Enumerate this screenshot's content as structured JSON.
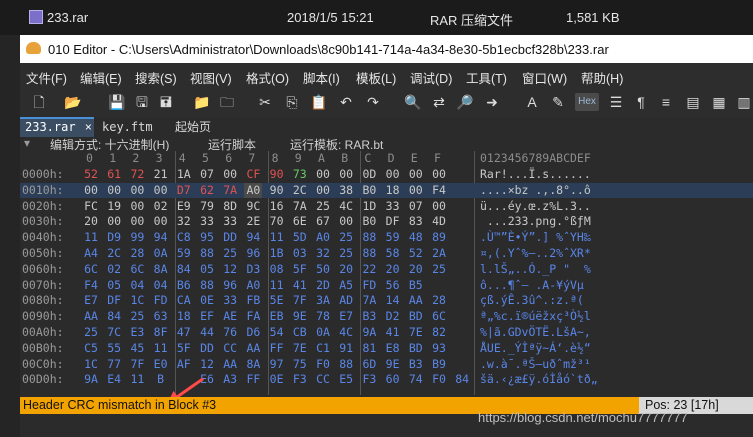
{
  "explorer": {
    "file_name": "233.rar",
    "file_date": "2018/1/5 15:21",
    "file_type": "RAR 压缩文件",
    "file_size": "1,581 KB"
  },
  "window": {
    "title": "010 Editor - C:\\Users\\Administrator\\Downloads\\8c90b141-714a-4a34-8e30-5b1ecbcf328b\\233.rar"
  },
  "menu": [
    "文件(F)",
    "编辑(E)",
    "搜索(S)",
    "视图(V)",
    "格式(O)",
    "脚本(I)",
    "模板(L)",
    "调试(D)",
    "工具(T)",
    "窗口(W)",
    "帮助(H)"
  ],
  "toolbar": {
    "hex_label": "Hex"
  },
  "tabs": [
    {
      "label": "233.rar",
      "close": "×"
    },
    {
      "label": "key.ftm"
    },
    {
      "label": "起始页"
    }
  ],
  "options": {
    "edit_mode": "编辑方式: 十六进制(H)",
    "run_script": "运行脚本",
    "run_template": "运行模板: RAR.bt"
  },
  "hex": {
    "column_headers": [
      "0",
      "1",
      "2",
      "3",
      "4",
      "5",
      "6",
      "7",
      "8",
      "9",
      "A",
      "B",
      "C",
      "D",
      "E",
      "F"
    ],
    "ascii_header": "0123456789ABCDEF",
    "rows": [
      {
        "addr": "0000h:",
        "bytes": [
          "52",
          "61",
          "72",
          "21",
          "1A",
          "07",
          "00",
          "CF",
          "90",
          "73",
          "00",
          "00",
          "0D",
          "00",
          "00",
          "00"
        ],
        "ascii": "Rar!...Ï.s......"
      },
      {
        "addr": "0010h:",
        "bytes": [
          "00",
          "00",
          "00",
          "00",
          "D7",
          "62",
          "7A",
          "A0",
          "90",
          "2C",
          "00",
          "38",
          "B0",
          "18",
          "00",
          "F4"
        ],
        "ascii": "....×bz .,.8°..ô"
      },
      {
        "addr": "0020h:",
        "bytes": [
          "FC",
          "19",
          "00",
          "02",
          "E9",
          "79",
          "8D",
          "9C",
          "16",
          "7A",
          "25",
          "4C",
          "1D",
          "33",
          "07",
          "00"
        ],
        "ascii": "ü...éy.œ.z%L.3.."
      },
      {
        "addr": "0030h:",
        "bytes": [
          "20",
          "00",
          "00",
          "00",
          "32",
          "33",
          "33",
          "2E",
          "70",
          "6E",
          "67",
          "00",
          "B0",
          "DF",
          "83",
          "4D"
        ],
        "ascii": " ...233.png.°ßƒM"
      },
      {
        "addr": "0040h:",
        "bytes": [
          "11",
          "D9",
          "99",
          "94",
          "C8",
          "95",
          "DD",
          "94",
          "11",
          "5D",
          "A0",
          "25",
          "88",
          "59",
          "48",
          "89"
        ],
        "ascii": ".Ù™”È•Ý”.] %ˆYH‰"
      },
      {
        "addr": "0050h:",
        "bytes": [
          "A4",
          "2C",
          "28",
          "0A",
          "59",
          "88",
          "25",
          "96",
          "1B",
          "03",
          "32",
          "25",
          "88",
          "58",
          "52",
          "2A"
        ],
        "ascii": "¤,(.Yˆ%–..2%ˆXR*"
      },
      {
        "addr": "0060h:",
        "bytes": [
          "6C",
          "02",
          "6C",
          "8A",
          "84",
          "05",
          "12",
          "D3",
          "08",
          "5F",
          "50",
          "20",
          "22",
          "20",
          "20",
          "25"
        ],
        "ascii": "l.lŠ„..Ó._P \"  %"
      },
      {
        "addr": "0070h:",
        "bytes": [
          "F4",
          "05",
          "04",
          "04",
          "B6",
          "88",
          "96",
          "A0",
          "11",
          "41",
          "2D",
          "A5",
          "FD",
          "56",
          "B5"
        ],
        "ascii": "ô...¶ˆ– .A-¥ýVµ"
      },
      {
        "addr": "0080h:",
        "bytes": [
          "E7",
          "DF",
          "1C",
          "FD",
          "CA",
          "0E",
          "33",
          "FB",
          "5E",
          "7F",
          "3A",
          "AD",
          "7A",
          "14",
          "AA",
          "28"
        ],
        "ascii": "çß.ýÊ.3û^.:­z.ª("
      },
      {
        "addr": "0090h:",
        "bytes": [
          "AA",
          "84",
          "25",
          "63",
          "18",
          "EF",
          "AE",
          "FA",
          "EB",
          "9E",
          "78",
          "E7",
          "B3",
          "D2",
          "BD",
          "6C"
        ],
        "ascii": "ª„%c.ï®úëžxç³Ò½l"
      },
      {
        "addr": "00A0h:",
        "bytes": [
          "25",
          "7C",
          "E3",
          "8F",
          "47",
          "44",
          "76",
          "D6",
          "54",
          "CB",
          "0A",
          "4C",
          "9A",
          "41",
          "7E",
          "82"
        ],
        "ascii": "%|ã.GDvÖTË.LšA~‚"
      },
      {
        "addr": "00B0h:",
        "bytes": [
          "C5",
          "55",
          "45",
          "11",
          "5F",
          "DD",
          "CC",
          "AA",
          "FF",
          "7E",
          "C1",
          "91",
          "81",
          "E8",
          "BD",
          "93"
        ],
        "ascii": "ÅUE._ÝÌªÿ~Á‘.è½“"
      },
      {
        "addr": "00C0h:",
        "bytes": [
          "1C",
          "77",
          "7F",
          "E0",
          "AF",
          "12",
          "AA",
          "8A",
          "97",
          "75",
          "F0",
          "88",
          "6D",
          "9E",
          "B3",
          "B9"
        ],
        "ascii": ".w.à¯.ªŠ—uðˆmž³¹"
      },
      {
        "addr": "00D0h:",
        "bytes": [
          "9A",
          "E4",
          "11",
          "B",
          "",
          "E6",
          "A3",
          "FF",
          "0E",
          "F3",
          "CC",
          "E5",
          "F3",
          "60",
          "74",
          "F0",
          "84"
        ],
        "ascii": "šä.‹¿æ£ÿ.óÌåó`tð„"
      }
    ]
  },
  "status": {
    "message": "Header CRC mismatch in Block #3",
    "position": "Pos: 23 [17h]"
  },
  "watermark": "https://blog.csdn.net/mochu7777777"
}
